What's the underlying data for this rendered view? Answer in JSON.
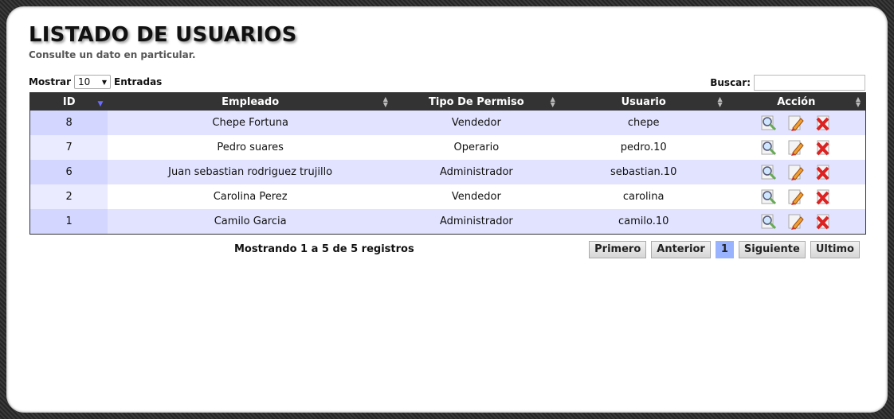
{
  "header": {
    "title": "LISTADO DE USUARIOS",
    "subtitle": "Consulte un dato en particular."
  },
  "length": {
    "prefix": "Mostrar",
    "value": "10",
    "suffix": "Entradas"
  },
  "search": {
    "label": "Buscar:",
    "value": ""
  },
  "table": {
    "columns": [
      "ID",
      "Empleado",
      "Tipo De Permiso",
      "Usuario",
      "Acción"
    ],
    "rows": [
      {
        "id": "8",
        "empleado": "Chepe Fortuna",
        "permiso": "Vendedor",
        "usuario": "chepe"
      },
      {
        "id": "7",
        "empleado": "Pedro suares",
        "permiso": "Operario",
        "usuario": "pedro.10"
      },
      {
        "id": "6",
        "empleado": "Juan sebastian rodriguez trujillo",
        "permiso": "Administrador",
        "usuario": "sebastian.10"
      },
      {
        "id": "2",
        "empleado": "Carolina Perez",
        "permiso": "Vendedor",
        "usuario": "carolina"
      },
      {
        "id": "1",
        "empleado": "Camilo Garcia",
        "permiso": "Administrador",
        "usuario": "camilo.10"
      }
    ],
    "action_icons": [
      "view-icon",
      "edit-icon",
      "delete-icon"
    ]
  },
  "footer": {
    "info": "Mostrando 1 a 5 de 5 registros",
    "first": "Primero",
    "previous": "Anterior",
    "page": "1",
    "next": "Siguiente",
    "last": "Ultimo"
  },
  "colors": {
    "header_bg": "#333333",
    "odd_row": "#e2e4ff",
    "current_page": "#99b3ff"
  }
}
